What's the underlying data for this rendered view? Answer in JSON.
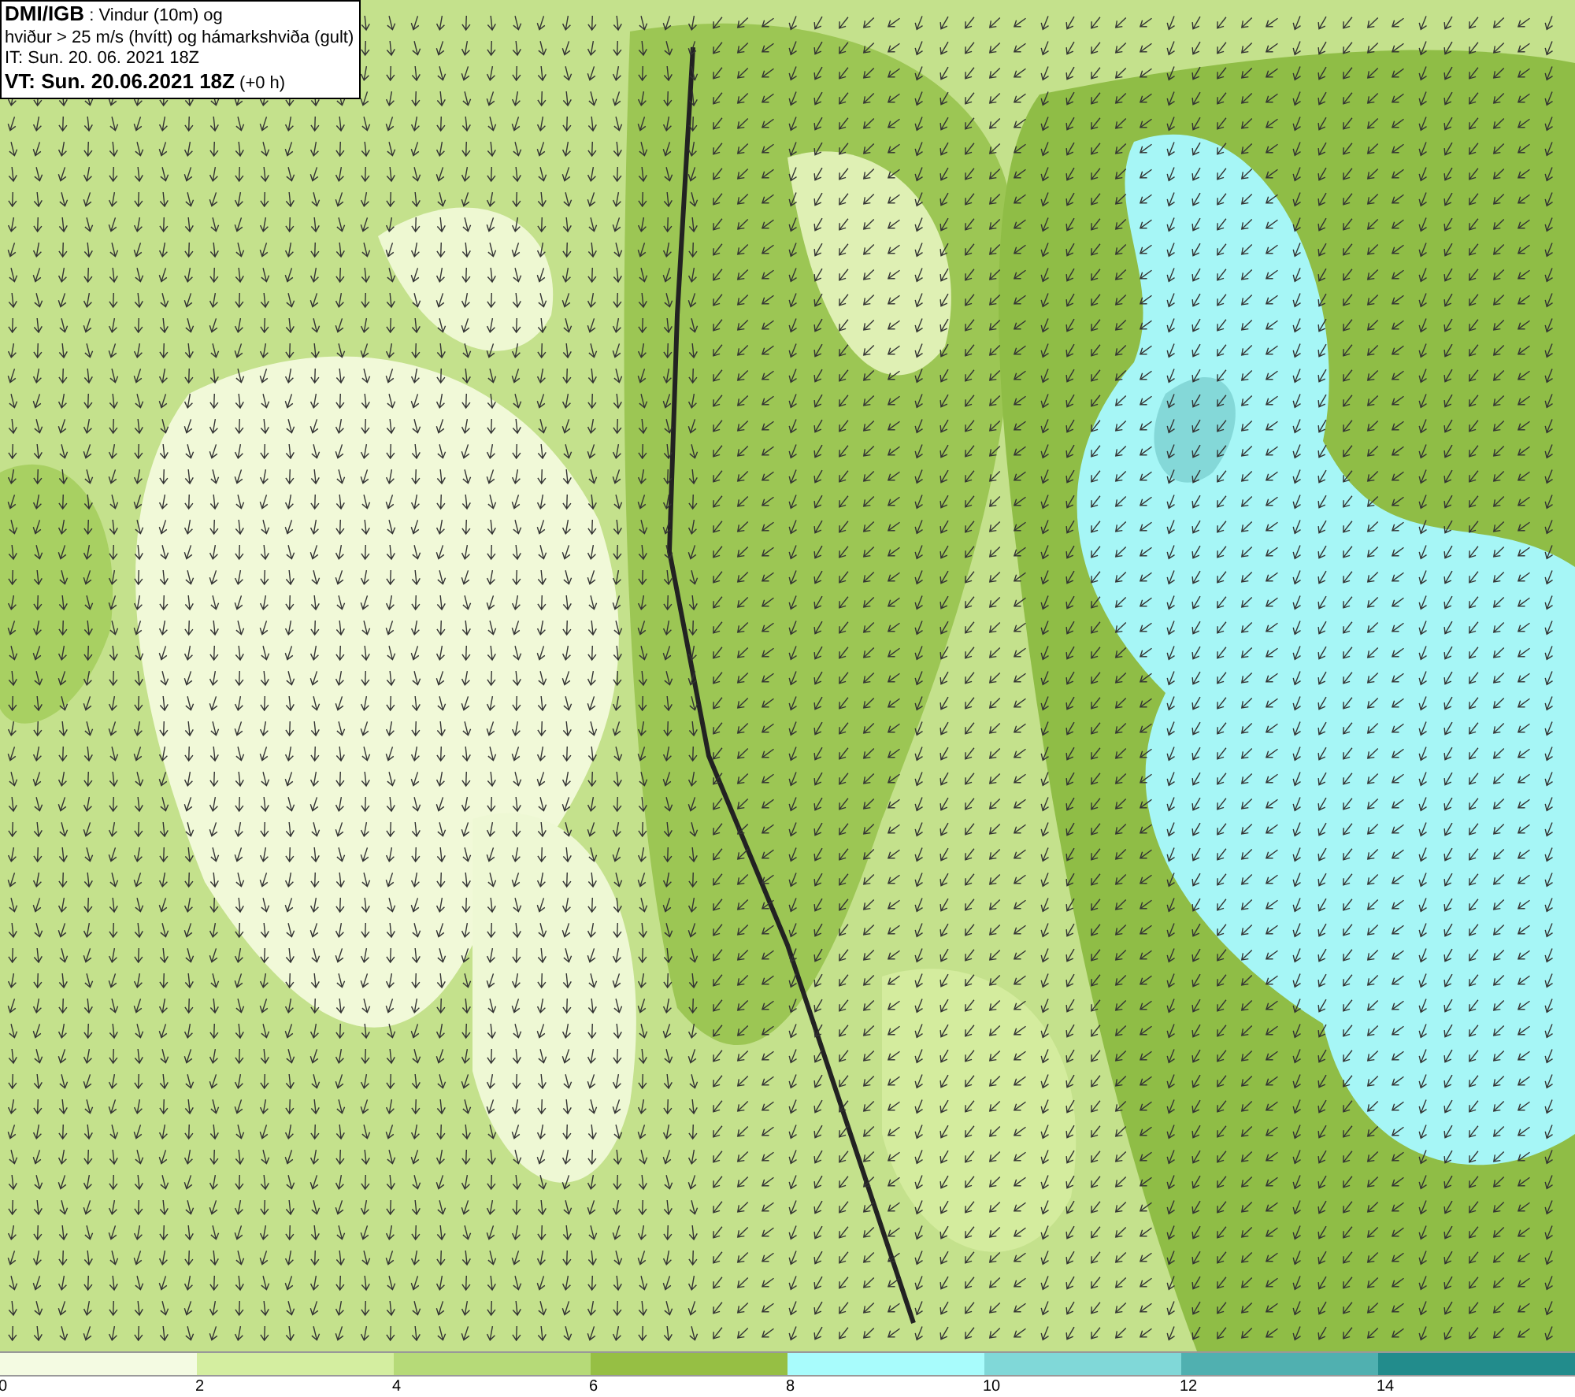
{
  "info_box": {
    "lines": [
      "**DMI/IGB** : Vindur (10m) og",
      "hviður > 25 m/s (hvítt) og hámarkshviða (gult)",
      "IT: Sun. 20. 06. 2021 18Z",
      "**VT: Sun. 20.06.2021 18Z** (+0 h)"
    ]
  },
  "legend": {
    "bins": [
      {
        "color": "#f4fbe2"
      },
      {
        "color": "#d4eea0"
      },
      {
        "color": "#b6da78"
      },
      {
        "color": "#96bf44"
      },
      {
        "color": "#a8fcfc"
      },
      {
        "color": "#80d8d8"
      },
      {
        "color": "#50b0b0"
      },
      {
        "color": "#228c8c"
      }
    ],
    "ticks": [
      "0",
      "2",
      "4",
      "6",
      "8",
      "10",
      "12",
      "14"
    ]
  }
}
